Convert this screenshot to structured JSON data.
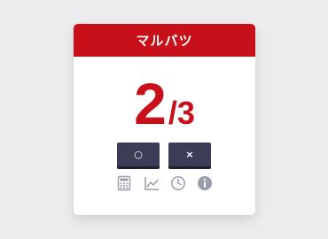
{
  "card": {
    "title": "マルバツ"
  },
  "score": {
    "current": "2",
    "separator": "/",
    "total": "3"
  },
  "buttons": {
    "correct_label": "○",
    "wrong_label": "×"
  },
  "toolbar": {
    "icons": [
      "calculator-icon",
      "line-chart-icon",
      "clock-icon",
      "info-icon"
    ]
  },
  "colors": {
    "accent": "#c8101a",
    "button": "#3b3d57",
    "icon": "#9a9cab",
    "background": "#ececee"
  }
}
